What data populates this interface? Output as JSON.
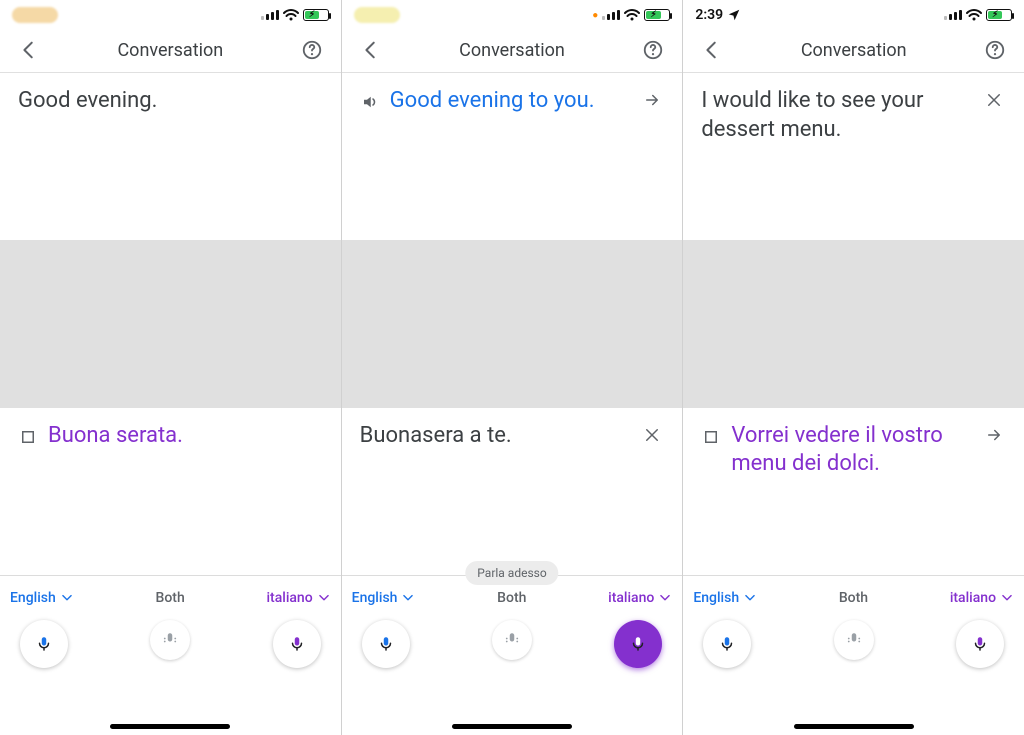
{
  "header_title": "Conversation",
  "footer": {
    "lang_left": "English",
    "lang_both": "Both",
    "lang_right": "italiano"
  },
  "screen1": {
    "status_time": "",
    "top_text": "Good evening.",
    "bottom_text": "Buona serata."
  },
  "screen2": {
    "status_time": "",
    "top_text": "Good evening to you.",
    "bottom_text": "Buonasera a te.",
    "chip": "Parla adesso"
  },
  "screen3": {
    "status_time": "2:39",
    "top_text": "I would like to see your dessert menu.",
    "bottom_text": "Vorrei vedere il vostro menu dei dolci."
  }
}
